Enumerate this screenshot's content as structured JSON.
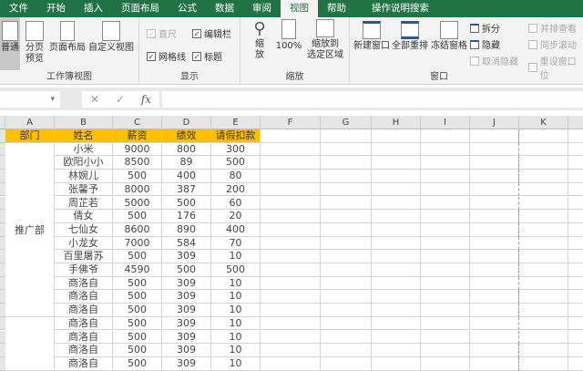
{
  "tabs": [
    "文件",
    "开始",
    "插入",
    "页面布局",
    "公式",
    "数据",
    "审阅",
    "视图",
    "帮助"
  ],
  "search_label": "操作说明搜索",
  "ribbon": {
    "workbook_views": {
      "label": "工作簿视图",
      "normal": "普通",
      "page_break": "分页\n预览",
      "page_layout": "页面布局",
      "custom": "自定义视图"
    },
    "show": {
      "label": "显示",
      "ruler": "直尺",
      "formula_bar": "编辑栏",
      "gridlines": "网格线",
      "headings": "标题"
    },
    "zoom": {
      "label": "缩放",
      "zoom": "缩\n放",
      "hundred": "100%",
      "zoom_sel": "缩放到\n选定区域"
    },
    "window": {
      "label": "窗口",
      "new": "新建窗口",
      "arrange": "全部重排",
      "freeze": "冻结窗格",
      "split": "拆分",
      "hide": "隐藏",
      "unhide": "取消隐藏",
      "side": "并排查看",
      "sync": "同步滚动",
      "reset": "重设窗口位"
    }
  },
  "formula": {
    "fx": "fx",
    "cancel": "✕",
    "enter": "✓"
  },
  "columns": [
    "A",
    "B",
    "C",
    "D",
    "E",
    "F",
    "G",
    "H",
    "I",
    "J",
    "K"
  ],
  "header_row": [
    "部门",
    "姓名",
    "薪资",
    "绩效",
    "请假扣款"
  ],
  "dept": "推广部",
  "rows": [
    [
      "小米",
      "9000",
      "800",
      "300"
    ],
    [
      "欧阳小小",
      "8500",
      "89",
      "500"
    ],
    [
      "林婉儿",
      "500",
      "400",
      "80"
    ],
    [
      "张馨予",
      "8000",
      "387",
      "200"
    ],
    [
      "周芷若",
      "5000",
      "500",
      "60"
    ],
    [
      "倩女",
      "500",
      "176",
      "20"
    ],
    [
      "七仙女",
      "8600",
      "890",
      "400"
    ],
    [
      "小龙女",
      "7000",
      "584",
      "70"
    ],
    [
      "百里屠苏",
      "500",
      "309",
      "10"
    ],
    [
      "手佛爷",
      "4590",
      "500",
      "500"
    ],
    [
      "商洛自",
      "500",
      "309",
      "10"
    ],
    [
      "商洛自",
      "500",
      "309",
      "10"
    ],
    [
      "商洛自",
      "500",
      "309",
      "10"
    ],
    [
      "商洛自",
      "500",
      "309",
      "10"
    ],
    [
      "商洛自",
      "500",
      "309",
      "10"
    ],
    [
      "商洛自",
      "500",
      "309",
      "10"
    ],
    [
      "商洛自",
      "500",
      "309",
      "10"
    ]
  ]
}
